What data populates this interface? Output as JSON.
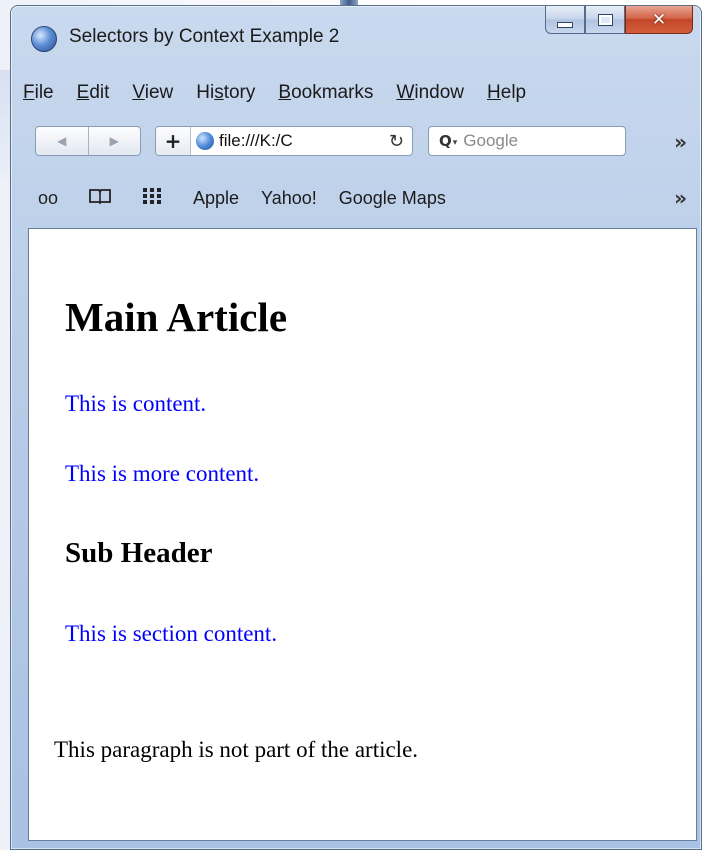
{
  "window": {
    "title": "Selectors by Context Example 2",
    "controls": {
      "minimize": "",
      "maximize": "",
      "close": "✕"
    }
  },
  "menubar": {
    "items": [
      {
        "label": "File",
        "accel": "F",
        "rest": "ile"
      },
      {
        "label": "Edit",
        "accel": "E",
        "rest": "dit"
      },
      {
        "label": "View",
        "accel": "V",
        "rest": "iew"
      },
      {
        "label": "History",
        "pre": "Hi",
        "accel": "s",
        "rest": "tory"
      },
      {
        "label": "Bookmarks",
        "accel": "B",
        "rest": "ookmarks"
      },
      {
        "label": "Window",
        "accel": "W",
        "rest": "indow"
      },
      {
        "label": "Help",
        "accel": "H",
        "rest": "elp"
      }
    ]
  },
  "navbar": {
    "back_glyph": "◀",
    "forward_glyph": "▶",
    "new_tab_glyph": "+",
    "url": "file:///K:/C",
    "reload_glyph": "↻",
    "search_icon": "search-icon",
    "search_glyph": "Q",
    "search_dropdown_glyph": "▾",
    "search_placeholder": "Google",
    "overflow_glyph": "»"
  },
  "bookmarks": {
    "icons": [
      {
        "name": "reading-glasses-icon",
        "glyph": "oo"
      },
      {
        "name": "open-book-icon",
        "glyph": "📖"
      },
      {
        "name": "grid-icon",
        "glyph": "▦"
      }
    ],
    "links": [
      "Apple",
      "Yahoo!",
      "Google Maps"
    ],
    "overflow_glyph": "»"
  },
  "page": {
    "heading": "Main Article",
    "paragraph1": "This is content.",
    "paragraph2": "This is more content.",
    "subheading": "Sub Header",
    "section_paragraph": "This is section content.",
    "outside_paragraph": "This paragraph is not part of the article."
  },
  "colors": {
    "article_text": "#0000ff",
    "heading_text": "#000000",
    "titlebar": "#c9d9ee",
    "close_button": "#c24628"
  }
}
